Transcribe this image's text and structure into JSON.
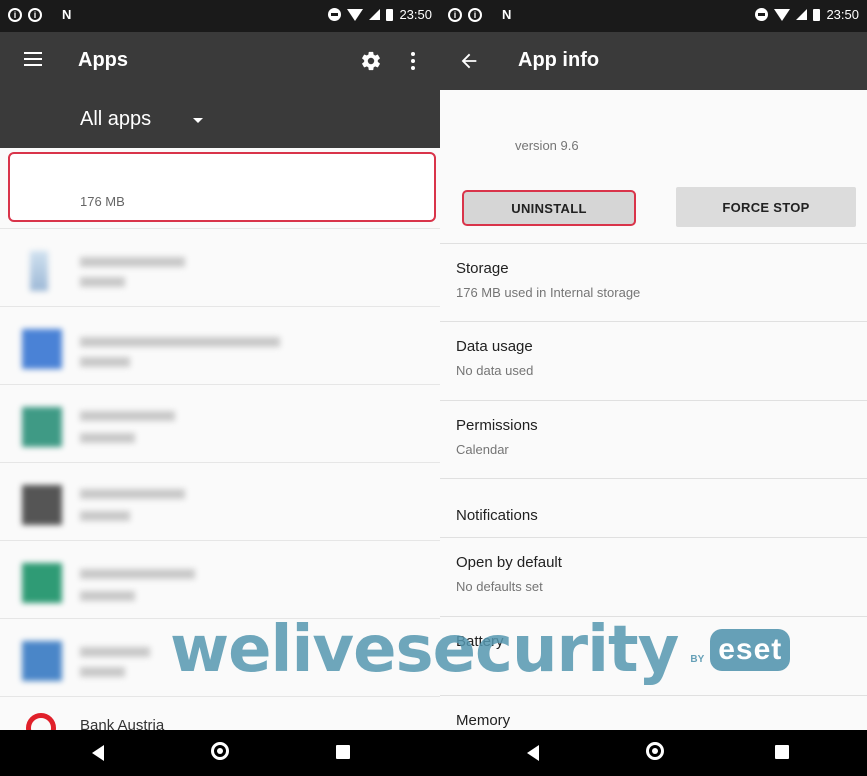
{
  "left_screen": {
    "status_bar": {
      "time": "23:50",
      "notification_letter": "N"
    },
    "app_bar": {
      "title": "Apps"
    },
    "filter": {
      "label": "All apps"
    },
    "selected_app": {
      "size": "176 MB"
    },
    "rows": [
      {
        "label": ""
      },
      {
        "label": ""
      },
      {
        "label": ""
      },
      {
        "label": ""
      },
      {
        "label": ""
      },
      {
        "label": ""
      },
      {
        "label": "Bank Austria"
      }
    ]
  },
  "right_screen": {
    "status_bar": {
      "time": "23:50",
      "notification_letter": "N"
    },
    "app_bar": {
      "title": "App info"
    },
    "version": "version 9.6",
    "buttons": {
      "uninstall": "UNINSTALL",
      "force_stop": "FORCE STOP"
    },
    "items": [
      {
        "title": "Storage",
        "subtitle": "176 MB used in Internal storage"
      },
      {
        "title": "Data usage",
        "subtitle": "No data used"
      },
      {
        "title": "Permissions",
        "subtitle": "Calendar"
      },
      {
        "title": "Notifications",
        "subtitle": ""
      },
      {
        "title": "Open by default",
        "subtitle": "No defaults set"
      },
      {
        "title": "Battery",
        "subtitle": ""
      },
      {
        "title": "Memory",
        "subtitle": ""
      }
    ]
  },
  "watermark": {
    "text": "welivesecurity",
    "by": "BY",
    "brand": "eset"
  },
  "colors": {
    "app_bar": "#3a3a3a",
    "highlight": "#d9344a",
    "watermark": "#5596af"
  }
}
